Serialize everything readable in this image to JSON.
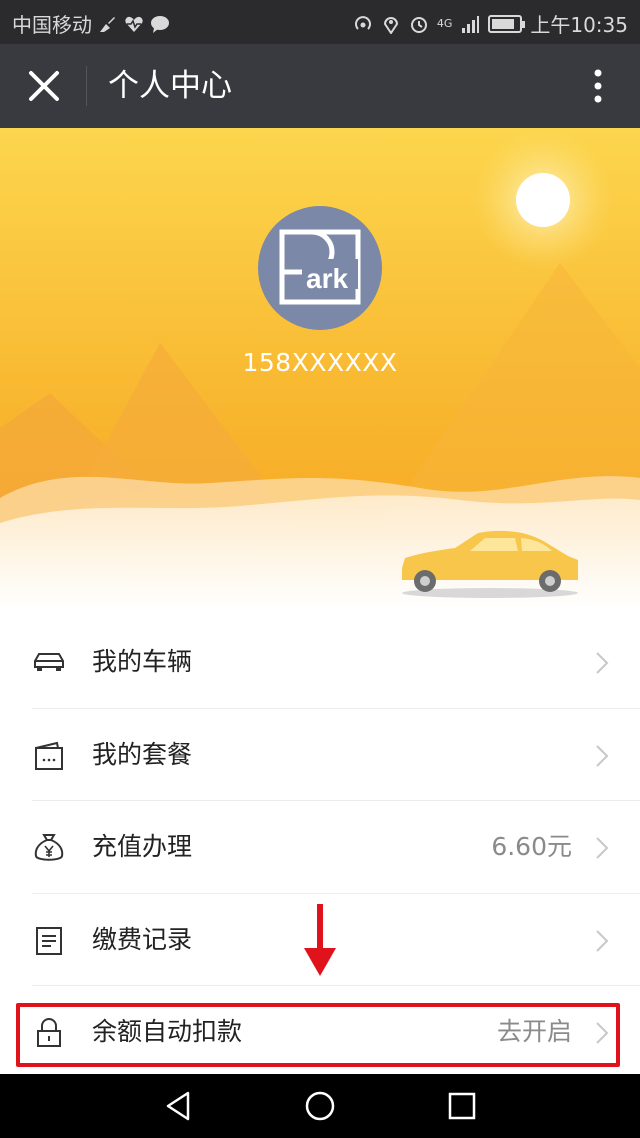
{
  "status_bar": {
    "carrier": "中国移动",
    "network": "4G",
    "time": "上午10:35",
    "icons": [
      "broom-icon",
      "heart-pulse-icon",
      "chat-bubble-icon",
      "hotspot-icon",
      "location-icon",
      "alarm-icon",
      "signal-icon",
      "battery-icon"
    ]
  },
  "header": {
    "title": "个人中心",
    "close_icon": "close-icon",
    "more_icon": "more-vertical-icon"
  },
  "profile": {
    "phone": "158XXXXXX",
    "avatar_text": "ark",
    "avatar_icon": "park-logo"
  },
  "menu": {
    "items": [
      {
        "label": "我的车辆",
        "value": "",
        "icon": "car-icon"
      },
      {
        "label": "我的套餐",
        "value": "",
        "icon": "wallet-icon"
      },
      {
        "label": "充值办理",
        "value": "6.60元",
        "icon": "money-bag-icon"
      },
      {
        "label": "缴费记录",
        "value": "",
        "icon": "document-icon"
      },
      {
        "label": "余额自动扣款",
        "value": "去开启",
        "icon": "lock-icon"
      }
    ]
  },
  "colors": {
    "banner_top": "#fcd64e",
    "banner_bottom": "#f6a623",
    "title_bar": "#393a3f",
    "highlight": "#e0121c",
    "avatar": "#7b88a8"
  },
  "nav_bar": {
    "back_icon": "back-triangle-icon",
    "home_icon": "home-circle-icon",
    "recent_icon": "recent-square-icon"
  }
}
